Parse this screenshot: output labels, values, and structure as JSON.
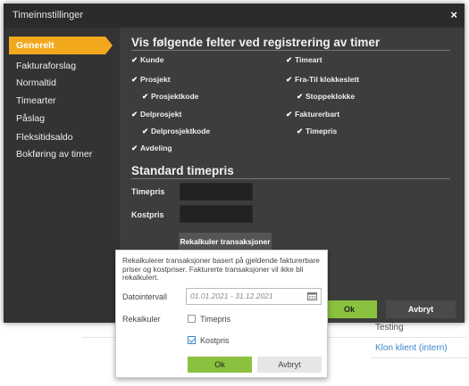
{
  "background": {
    "testing": "Testing",
    "klon_klient": "Klon klient (intern)"
  },
  "dialog": {
    "title": "Timeinnstillinger",
    "close": "×",
    "nav": [
      "Generelt",
      "Fakturaforslag",
      "Normaltid",
      "Timearter",
      "Påslag",
      "Fleksitidsaldo",
      "Bokføring av timer"
    ],
    "section_fields_title": "Vis følgende felter ved registrering av timer",
    "fields_left": [
      {
        "label": "Kunde",
        "checked": true
      },
      {
        "label": "Prosjekt",
        "checked": true
      },
      {
        "label": "Prosjektkode",
        "checked": true
      },
      {
        "label": "Delprosjekt",
        "checked": true
      },
      {
        "label": "Delprosjektkode",
        "checked": true
      },
      {
        "label": "Avdeling",
        "checked": true
      }
    ],
    "fields_right": [
      {
        "label": "Timeart",
        "checked": true
      },
      {
        "label": "Fra-Til klokkeslett",
        "checked": true
      },
      {
        "label": "Stoppeklokke",
        "checked": true
      },
      {
        "label": "Fakturerbart",
        "checked": true
      },
      {
        "label": "Timepris",
        "checked": true
      }
    ],
    "section_price_title": "Standard timepris",
    "timepris_label": "Timepris",
    "timepris_value": "",
    "kostpris_label": "Kostpris",
    "kostpris_value": "",
    "recalc_button": "Rekalkuler transaksjoner",
    "ok_button": "Ok",
    "cancel_button": "Avbryt"
  },
  "popup": {
    "description": "Rekalkulerer transaksjoner basert på gjeldende fakturerbare priser og kostpriser. Fakturerte transaksjoner vil ikke bli rekalkulert.",
    "date_label": "Datointervall",
    "date_value": "01.01.2021 - 31.12.2021",
    "recalc_label": "Rekalkuler",
    "opt_timepris": "Timepris",
    "opt_timepris_checked": false,
    "opt_kostpris": "Kostpris",
    "opt_kostpris_checked": true,
    "ok_button": "Ok",
    "cancel_button": "Avbryt"
  },
  "colors": {
    "accent": "#f2a81d",
    "ok_green": "#8ac13f",
    "dialog_bg": "#3d3d3d",
    "link_blue": "#3a87c8"
  }
}
